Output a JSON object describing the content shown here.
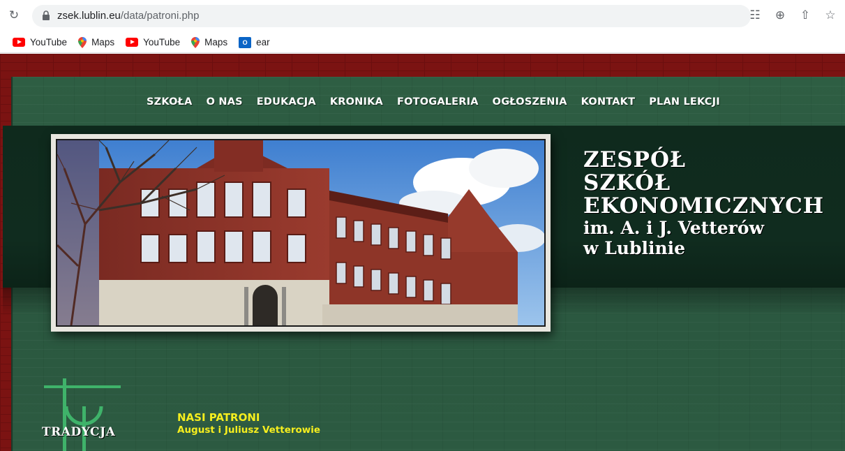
{
  "browser": {
    "url_host": "zsek.lublin.eu",
    "url_path": "/data/patroni.php",
    "icons": [
      "reload-icon",
      "lock-icon",
      "translate-icon",
      "zoom-icon",
      "share-icon",
      "bookmark-star-icon"
    ]
  },
  "bookmarks": [
    {
      "label": "YouTube",
      "icon": "youtube-icon"
    },
    {
      "label": "Maps",
      "icon": "maps-icon"
    },
    {
      "label": "YouTube",
      "icon": "youtube-icon"
    },
    {
      "label": "Maps",
      "icon": "maps-icon"
    },
    {
      "label": "ear",
      "icon": "outlook-icon"
    }
  ],
  "nav": [
    "SZKOŁA",
    "O NAS",
    "EDUKACJA",
    "KRONIKA",
    "FOTOGALERIA",
    "OGŁOSZENIA",
    "KONTAKT",
    "PLAN LEKCJI"
  ],
  "school": {
    "line1": "ZESPÓŁ",
    "line2": "SZKÓŁ",
    "line3": "EKONOMICZNYCH",
    "line4": "im. A. i J. Vetterów",
    "line5": "w Lublinie"
  },
  "logo": {
    "text": "TRADYCJA"
  },
  "patroni": {
    "title": "NASI PATRONI",
    "subtitle": "August i Juliusz Vetterowie"
  },
  "colors": {
    "brick": "#7b1312",
    "green": "#2c5a41",
    "dark_band": "#0f2a1d",
    "accent_yellow": "#f6ee1e"
  }
}
